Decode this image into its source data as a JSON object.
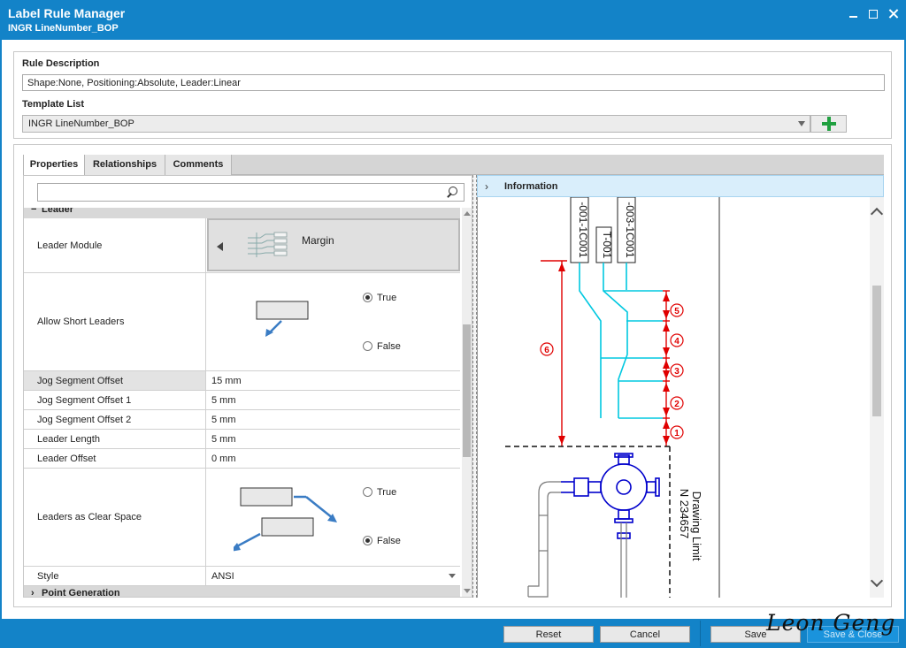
{
  "window": {
    "title": "Label Rule Manager",
    "subtitle": "INGR LineNumber_BOP"
  },
  "rule": {
    "description_label": "Rule Description",
    "description_value": "Shape:None, Positioning:Absolute, Leader:Linear",
    "template_label": "Template List",
    "template_value": "INGR LineNumber_BOP"
  },
  "tabs": [
    "Properties",
    "Relationships",
    "Comments"
  ],
  "properties": {
    "category_leader": "Leader",
    "category_next": "Point Generation",
    "leader_module": {
      "label": "Leader Module",
      "value": "Margin"
    },
    "allow_short": {
      "label": "Allow Short Leaders",
      "true_label": "True",
      "false_label": "False",
      "selected": "True"
    },
    "rows": [
      {
        "label": "Jog Segment Offset",
        "value": "15 mm"
      },
      {
        "label": "Jog Segment Offset 1",
        "value": "5 mm"
      },
      {
        "label": "Jog Segment Offset 2",
        "value": "5 mm"
      },
      {
        "label": "Leader Length",
        "value": "5 mm"
      },
      {
        "label": "Leader Offset",
        "value": "0 mm"
      }
    ],
    "clear_space": {
      "label": "Leaders as Clear Space",
      "true_label": "True",
      "false_label": "False",
      "selected": "False"
    },
    "style": {
      "label": "Style",
      "value": "ANSI"
    }
  },
  "info": {
    "header": "Information",
    "drawing": {
      "pipe_labels": [
        "-001-1C001",
        "T-001",
        "-003-1C001"
      ],
      "dims": [
        "6",
        "5",
        "4",
        "3",
        "2",
        "1"
      ],
      "limit_text_1": "N 234657",
      "limit_text_2": "Drawing Limit"
    }
  },
  "footer": {
    "reset": "Reset",
    "cancel": "Cancel",
    "save": "Save",
    "save_close": "Save & Close"
  },
  "watermark": "Leon Geng",
  "colors": {
    "chrome_blue": "#1383c8",
    "dim_red": "#e00000",
    "pipe_cyan": "#00c8e0",
    "valve_blue": "#0000cc",
    "add_green": "#20a040"
  }
}
